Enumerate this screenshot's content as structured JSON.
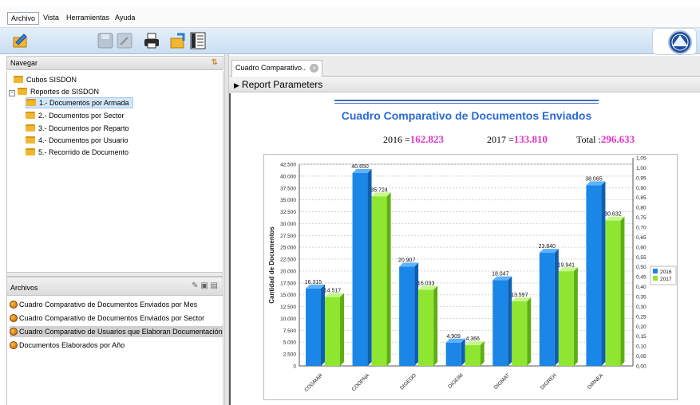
{
  "menubar": {
    "items": [
      "Archivo",
      "Vista",
      "Herramientas",
      "Ayuda"
    ]
  },
  "toolbar": {
    "icons": [
      "new-report-icon",
      "save-icon",
      "edit-icon",
      "print-icon",
      "export-icon",
      "columns-icon"
    ]
  },
  "navigator": {
    "title": "Navegar",
    "items": [
      {
        "label": "Cubos SISDON",
        "level": 0,
        "type": "folder"
      },
      {
        "label": "Reportes de SISDON",
        "level": 0,
        "type": "folder",
        "expanded": true
      },
      {
        "label": "1.- Documentos por Armada",
        "level": 1,
        "type": "folder",
        "selected": true
      },
      {
        "label": "2.- Documentos por Sector",
        "level": 1,
        "type": "folder"
      },
      {
        "label": "3.- Documentos por Reparto",
        "level": 1,
        "type": "folder"
      },
      {
        "label": "4.- Documentos por Usuario",
        "level": 1,
        "type": "folder"
      },
      {
        "label": "5.- Recorrido de Documento",
        "level": 1,
        "type": "folder"
      }
    ]
  },
  "archivos": {
    "title": "Archivos",
    "items": [
      {
        "label": "Cuadro Comparativo de Documentos Enviados por Mes"
      },
      {
        "label": "Cuadro Comparativo de Documentos Enviados por Sector"
      },
      {
        "label": "Cuadro Comparativo de Usuarios que Elaboran Documentación",
        "selected": true
      },
      {
        "label": "Documentos Elaborados por Año"
      }
    ]
  },
  "tab": {
    "label": "Cuadro Comparativo.."
  },
  "params": {
    "label": "Report Parameters"
  },
  "report": {
    "title": "Cuadro Comparativo de Documentos Enviados",
    "totals": [
      {
        "label": "2016 =",
        "value": "162.823"
      },
      {
        "label": "2017 =",
        "value": "133.810"
      },
      {
        "label": "Total :",
        "value": "296.633"
      }
    ]
  },
  "colors": {
    "accent": "#2a6ad6",
    "series_2016": "#1a86e8",
    "series_2017": "#8ee630",
    "totals": "#e033c8"
  },
  "chart_data": {
    "type": "bar",
    "title": "",
    "xlabel": "",
    "ylabel": "Cantidad de Documentos",
    "categories": [
      "COGMAR",
      "COOPNA",
      "DIGEDO",
      "DIGEIM",
      "DIGMAT",
      "DIGREH",
      "DIRNEA"
    ],
    "series": [
      {
        "name": "2016",
        "values": [
          16315,
          40650,
          20907,
          4909,
          18047,
          23840,
          38065
        ],
        "labels": [
          "16.315",
          "40.650",
          "20.907",
          "4.909",
          "18.047",
          "23.840",
          "38.065"
        ]
      },
      {
        "name": "2017",
        "values": [
          14517,
          35724,
          16033,
          4366,
          13597,
          19941,
          30632
        ],
        "labels": [
          "14.517",
          "35.724",
          "16.033",
          "4.366",
          "13.597",
          "19.941",
          "30.632"
        ]
      }
    ],
    "ylim": [
      0,
      42500
    ],
    "yticks": [
      "0",
      "2.500",
      "5.000",
      "7.500",
      "10.000",
      "12.500",
      "15.000",
      "17.500",
      "20.000",
      "22.500",
      "25.000",
      "27.500",
      "30.000",
      "32.500",
      "35.000",
      "37.500",
      "40.000",
      "42.500"
    ],
    "y2ticks": [
      "0,00",
      "0,05",
      "0,10",
      "0,15",
      "0,20",
      "0,25",
      "0,30",
      "0,35",
      "0,40",
      "0,45",
      "0,50",
      "0,55",
      "0,60",
      "0,65",
      "0,70",
      "0,75",
      "0,80",
      "0,85",
      "0,90",
      "0,95",
      "1,00",
      "1,05"
    ],
    "grid": true,
    "legend": "right"
  }
}
